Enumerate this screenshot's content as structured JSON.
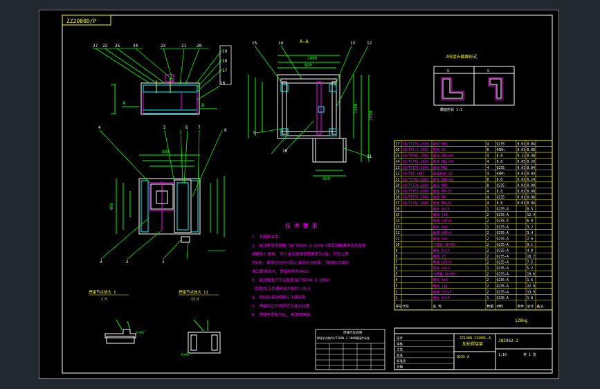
{
  "drawing": {
    "stamp_code": "ZZ2080D/P",
    "section_label": "A—A",
    "iso_label": "Z形接头截面形式",
    "frame_label": "图纸比例",
    "tech_title": "技 术 要 求",
    "tech_notes": [
      "1. 不需抹油漆。",
      "2. 未注焊缝焊接按 JB/T5000.3-2000《重型机械通用技术条件",
      "   焊接件》焊接. 尺寸未注偏差极限偏差为C级, 形位公差",
      "   为C级, 焊接后应进行回火消除应力处理, 焊接前应清除",
      "   坡口铁锈油污, 焊接材料为J422。",
      "3. 未注线性尺寸公差按JB/T5000.3-2000",
      "   《切削加工件通用技术条件》执行。",
      "4. 焊后应清除焊渣与飞溅物等",
      "5. 焊接后应作消除应力退火处理。",
      "6. 焊缝不得有气孔, 夹渣等缺陷。"
    ],
    "detail_1_title": "焊接节点放大 I",
    "detail_1_scale": "I:5",
    "detail_2_title": "焊接节点放大 II",
    "detail_2_scale": "II:5",
    "weld_table_title": "焊缝代号说明",
    "weld_note": "焊接节点按JB/T5000.3-2000焊接件标准",
    "callouts_top": [
      "27",
      "22",
      "25",
      "24",
      "23",
      "21",
      "20",
      "19",
      "18",
      "17",
      "16"
    ],
    "callouts_section": [
      "15",
      "14",
      "13",
      "12",
      "11",
      "10",
      "9"
    ],
    "callouts_mid": [
      "4",
      "5",
      "6",
      "7",
      "8",
      "3",
      "2",
      "1"
    ],
    "dim_1": "1080",
    "dim_2": "820",
    "dim_3": "1160",
    "dim_4": "1520",
    "dim_5": "420",
    "dim_6": "580",
    "dim_7": "400"
  },
  "parts_table": {
    "rows": [
      {
        "no": "27",
        "code": "GB/T6170-2000",
        "name": "螺母 M16",
        "qty": "4",
        "mat": "Q235",
        "w1": "0.01",
        "w2": "0.04"
      },
      {
        "no": "26",
        "code": "GB/T97.1-2002",
        "name": "垫圈 16",
        "qty": "8",
        "mat": "65Mn",
        "w1": "0.01",
        "w2": "0.08"
      },
      {
        "no": "25",
        "code": "GB/T5782-2000",
        "name": "螺栓 M16×60",
        "qty": "4",
        "mat": "8.8",
        "w1": "0.12",
        "w2": "0.48"
      },
      {
        "no": "24",
        "code": "GB/T5782-2000",
        "name": "螺栓 M12×40",
        "qty": "4",
        "mat": "8.8",
        "w1": "0.05",
        "w2": "0.20"
      },
      {
        "no": "23",
        "code": "GB/T6170-2000",
        "name": "螺母 M12",
        "qty": "4",
        "mat": "Q235",
        "w1": "0.01",
        "w2": "0.04"
      },
      {
        "no": "22",
        "code": "GB/T93-1987",
        "name": "弹簧垫圈 12",
        "qty": "4",
        "mat": "65Mn",
        "w1": "0.01",
        "w2": "0.04"
      },
      {
        "no": "21",
        "code": "GB/T5782-2000",
        "name": "螺栓 M10×35",
        "qty": "8",
        "mat": "8.8",
        "w1": "0.03",
        "w2": "0.24"
      },
      {
        "no": "20",
        "code": "GB/T6170-2000",
        "name": "螺母 M10",
        "qty": "8",
        "mat": "Q235",
        "w1": "0.01",
        "w2": "0.08"
      },
      {
        "no": "19",
        "code": "GB/T5783-2000",
        "name": "螺栓 M8×25",
        "qty": "4",
        "mat": "8.8",
        "w1": "0.02",
        "w2": "0.08"
      },
      {
        "no": "18",
        "code": "GB/T6170-2000",
        "name": "螺母 M8",
        "qty": "4",
        "mat": "Q235",
        "w1": "0.01",
        "w2": "0.04"
      },
      {
        "no": "17",
        "code": "GB/T5782-2000",
        "name": "螺栓 M6×20",
        "qty": "4",
        "mat": "8.8",
        "w1": "0.01",
        "w2": "0.04"
      },
      {
        "no": "16",
        "code": "",
        "name": "钢板 δ=10",
        "qty": "1",
        "mat": "Q235-A",
        "w1": "",
        "w2": "8.5"
      },
      {
        "no": "15",
        "code": "",
        "name": "槽钢 [10",
        "qty": "2",
        "mat": "Q235-A",
        "w1": "",
        "w2": "12.4"
      },
      {
        "no": "14",
        "code": "",
        "name": "角钢 L50×5",
        "qty": "2",
        "mat": "Q235-A",
        "w1": "",
        "w2": "6.8"
      },
      {
        "no": "13",
        "code": "",
        "name": "钢板 δ=8",
        "qty": "1",
        "mat": "Q235-A",
        "w1": "",
        "w2": "3.2"
      },
      {
        "no": "12",
        "code": "",
        "name": "角钢 L40×4",
        "qty": "2",
        "mat": "Q235-A",
        "w1": "",
        "w2": "3.4"
      },
      {
        "no": "11",
        "code": "",
        "name": "钢板 δ=6",
        "qty": "2",
        "mat": "Q235-A",
        "w1": "",
        "w2": "2.6"
      },
      {
        "no": "10",
        "code": "",
        "name": "方钢管 60×60",
        "qty": "2",
        "mat": "Q235-A",
        "w1": "",
        "w2": "9.1"
      },
      {
        "no": "9",
        "code": "",
        "name": "钢板 δ=10",
        "qty": "2",
        "mat": "Q235-A",
        "w1": "",
        "w2": "4.8"
      },
      {
        "no": "8",
        "code": "",
        "name": "槽钢 [8",
        "qty": "2",
        "mat": "Q235-A",
        "w1": "",
        "w2": "18.7"
      },
      {
        "no": "7",
        "code": "",
        "name": "角钢 L63×6",
        "qty": "2",
        "mat": "Q235-A",
        "w1": "",
        "w2": "7.5"
      },
      {
        "no": "6",
        "code": "",
        "name": "钢板 δ=12",
        "qty": "1",
        "mat": "Q235-A",
        "w1": "",
        "w2": "5.2"
      },
      {
        "no": "5",
        "code": "",
        "name": "方钢管 80×80",
        "qty": "2",
        "mat": "Q235-A",
        "w1": "",
        "w2": "19.6"
      },
      {
        "no": "4",
        "code": "",
        "name": "钢板 δ=8",
        "qty": "2",
        "mat": "Q235-A",
        "w1": "",
        "w2": "1.6"
      },
      {
        "no": "3",
        "code": "",
        "name": "槽钢 [12",
        "qty": "2",
        "mat": "Q235-A",
        "w1": "",
        "w2": "22.9"
      },
      {
        "no": "2",
        "code": "",
        "name": "角钢 L50×5",
        "qty": "2",
        "mat": "Q235-A",
        "w1": "",
        "w2": "13.9"
      },
      {
        "no": "1",
        "code": "",
        "name": "钢板 δ=10",
        "qty": "1",
        "mat": "Q235-A",
        "w1": "",
        "w2": "1.8"
      }
    ],
    "header": {
      "no": "序号",
      "code": "代号",
      "name": "名 称",
      "qty": "数量",
      "mat": "材料",
      "w1": "单件",
      "w2": "总计",
      "note": "备注"
    },
    "total_weight": "128kg"
  },
  "title_block": {
    "school": "ZZ1280-13200L-A",
    "title": "加长焊接架",
    "drawing_no": "JQ2062-2",
    "scale": "1:10",
    "sheet": "共 1 张",
    "material": "Q235-A",
    "cells": [
      "设计",
      "审核",
      "工艺",
      "批准",
      "标准化",
      "日期"
    ]
  }
}
